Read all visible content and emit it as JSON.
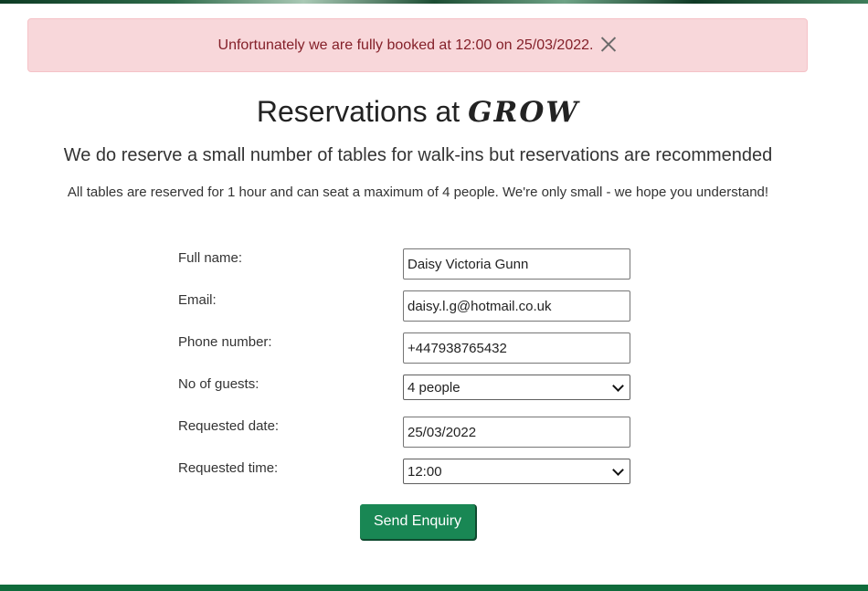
{
  "alert": {
    "message": "Unfortunately we are fully booked at 12:00 on 25/03/2022.",
    "close_icon": "close-icon"
  },
  "heading": {
    "prefix": "Reservations at",
    "brand": "GROW"
  },
  "subheading": "We do reserve a small number of tables for walk-ins but reservations are recommended",
  "note": "All tables are reserved for 1 hour and can seat a maximum of 4 people. We're only small - we hope you understand!",
  "form": {
    "full_name": {
      "label": "Full name:",
      "value": "Daisy Victoria Gunn"
    },
    "email": {
      "label": "Email:",
      "value": "daisy.l.g@hotmail.co.uk"
    },
    "phone": {
      "label": "Phone number:",
      "value": "+447938765432"
    },
    "guests": {
      "label": "No of guests:",
      "value": "4 people"
    },
    "date": {
      "label": "Requested date:",
      "value": "25/03/2022"
    },
    "time": {
      "label": "Requested time:",
      "value": "12:00"
    },
    "submit_label": "Send Enquiry"
  },
  "colors": {
    "alert_bg": "#f8d7da",
    "alert_text": "#842029",
    "button_bg": "#198754",
    "footer": "#0f6b3b"
  }
}
